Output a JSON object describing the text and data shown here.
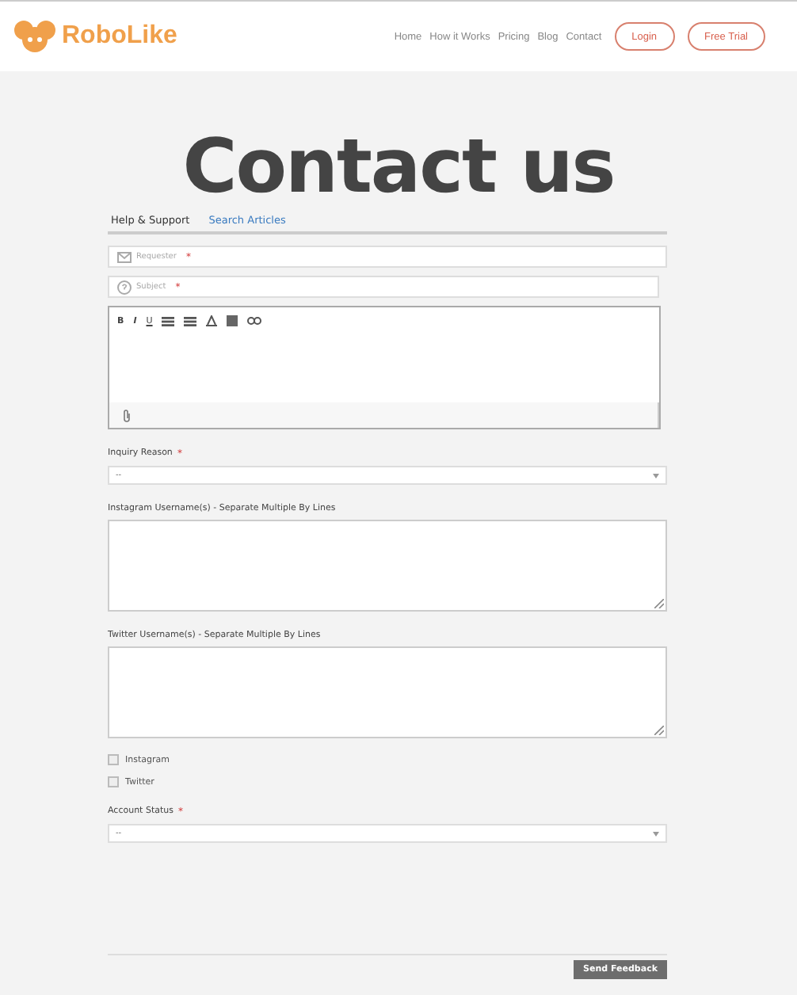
{
  "header": {
    "brand": "RoboLike",
    "nav": [
      "Home",
      "How it Works",
      "Pricing",
      "Blog",
      "Contact"
    ],
    "buttons": [
      "Login",
      "Free Trial"
    ]
  },
  "title": "Contact us",
  "tabs": [
    {
      "label": "Help & Support",
      "selected": true
    },
    {
      "label": "Search Articles",
      "selected": false
    }
  ],
  "fields": [
    {
      "kind": "input",
      "placeholder": "Requester",
      "required_mark": "*"
    },
    {
      "kind": "input",
      "placeholder": "Subject",
      "required_mark": "*"
    },
    {
      "kind": "editor",
      "toolbar": [
        "B",
        "I",
        "U"
      ]
    },
    {
      "kind": "select",
      "label": "Inquiry Reason",
      "required_mark": "*",
      "value": "--"
    },
    {
      "kind": "textarea",
      "label": "Instagram Username(s) - Separate Multiple By Lines"
    },
    {
      "kind": "textarea",
      "label": "Twitter Username(s) - Separate Multiple By Lines"
    },
    {
      "kind": "checkbox",
      "label": "Instagram",
      "checked": false
    },
    {
      "kind": "checkbox",
      "label": "Twitter",
      "checked": false
    },
    {
      "kind": "select",
      "label": "Account Status",
      "required_mark": "*",
      "value": "--"
    }
  ],
  "submit": "Send Feedback"
}
